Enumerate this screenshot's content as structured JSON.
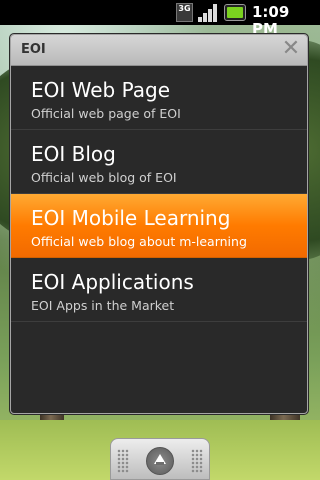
{
  "status_bar": {
    "network": "3G",
    "time": "1:09 PM",
    "icons": [
      "3g-icon",
      "signal-icon",
      "battery-icon"
    ]
  },
  "dialog": {
    "title": "EOI",
    "close_icon": "close-icon",
    "items": [
      {
        "title": "EOI Web Page",
        "subtitle": "Official web page of EOI",
        "selected": false
      },
      {
        "title": "EOI Blog",
        "subtitle": "Official web blog of EOI",
        "selected": false
      },
      {
        "title": "EOI Mobile Learning",
        "subtitle": "Official web blog about m-learning",
        "selected": true
      },
      {
        "title": "EOI Applications",
        "subtitle": "EOI Apps in the Market",
        "selected": false
      }
    ]
  },
  "colors": {
    "selected_highlight": "#ff8a00",
    "dialog_background": "#292929",
    "header_background": "#c8c8c8"
  }
}
